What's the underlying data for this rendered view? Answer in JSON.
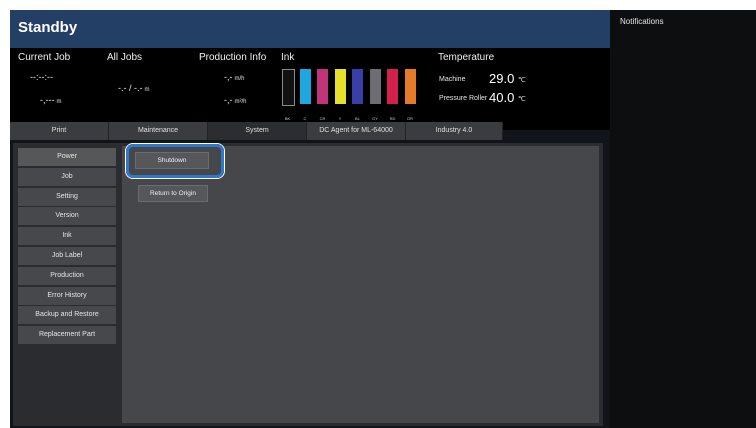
{
  "window": {
    "title": "Standby"
  },
  "info": {
    "current_job": {
      "label": "Current Job",
      "time": "--:--:--",
      "length": "-,---",
      "length_unit": "m"
    },
    "all_jobs": {
      "label": "All Jobs",
      "value": "-.- / -.-",
      "unit": "m"
    },
    "production_info": {
      "label": "Production Info",
      "rate1": "-,-",
      "rate1_unit": "m/h",
      "rate2": "-,-",
      "rate2_unit": "m²/h"
    },
    "ink": {
      "label": "Ink",
      "colors": [
        {
          "code": "BK",
          "color": "#111111"
        },
        {
          "code": "C",
          "color": "#1fa6df"
        },
        {
          "code": "CR",
          "color": "#c2347a"
        },
        {
          "code": "Y",
          "color": "#e6df2b"
        },
        {
          "code": "BL",
          "color": "#3a3fa8"
        },
        {
          "code": "GY",
          "color": "#6e6e72"
        },
        {
          "code": "RD",
          "color": "#d2214b"
        },
        {
          "code": "OR",
          "color": "#e47a2a"
        }
      ]
    },
    "temperature": {
      "label": "Temperature",
      "machine_label": "Machine",
      "machine_value": "29.0",
      "machine_unit": "℃",
      "roller_label": "Pressure Roller",
      "roller_value": "40.0",
      "roller_unit": "℃"
    }
  },
  "tabs": [
    "Print",
    "Maintenance",
    "System",
    "DC Agent for ML-64000",
    "Industry 4.0"
  ],
  "sidebar": [
    "Power",
    "Job",
    "Setting",
    "Version",
    "Ink",
    "Job Label",
    "Production",
    "Error History",
    "Backup and Restore",
    "Replacement Part"
  ],
  "content": {
    "shutdown": "Shutdown",
    "return_to_origin": "Return to Origin"
  },
  "notifications": {
    "label": "Notifications"
  }
}
